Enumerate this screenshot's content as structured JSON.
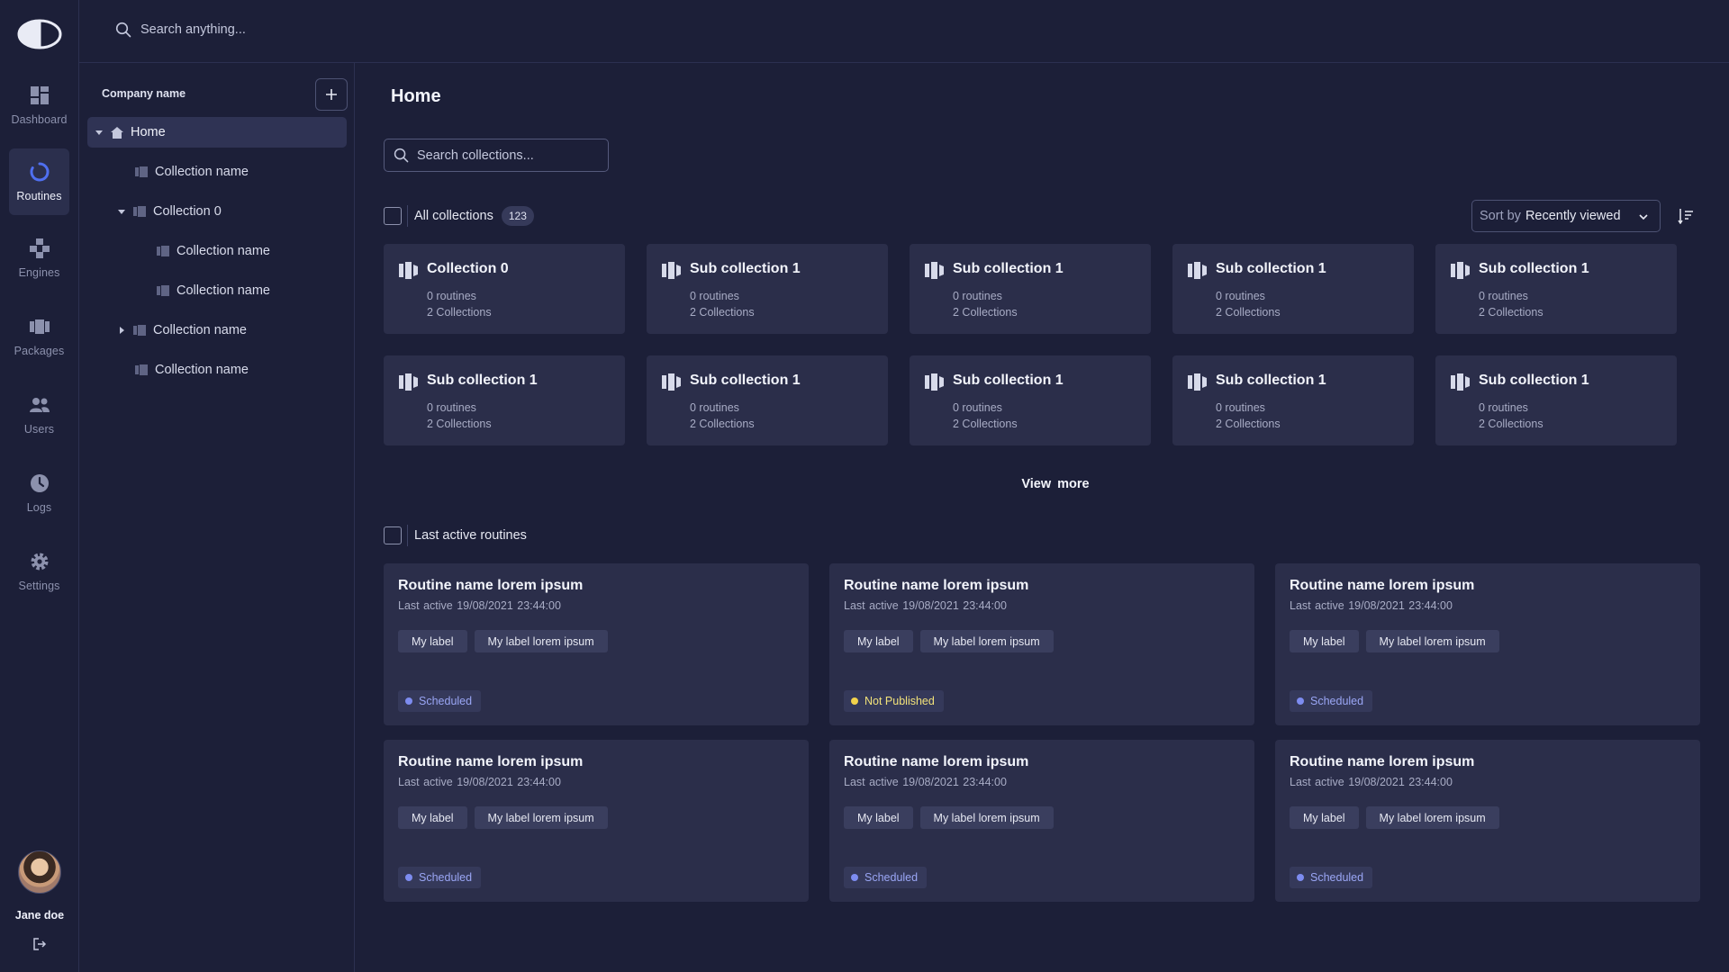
{
  "app": {
    "search_placeholder": "Search anything..."
  },
  "nav": {
    "items": [
      {
        "label": "Dashboard",
        "icon": "dashboard-icon"
      },
      {
        "label": "Routines",
        "icon": "routines-icon",
        "active": true
      },
      {
        "label": "Engines",
        "icon": "engines-icon"
      },
      {
        "label": "Packages",
        "icon": "packages-icon"
      },
      {
        "label": "Users",
        "icon": "users-icon"
      },
      {
        "label": "Logs",
        "icon": "logs-icon"
      },
      {
        "label": "Settings",
        "icon": "settings-icon"
      }
    ],
    "user_name": "Jane doe"
  },
  "tree": {
    "company": "Company name",
    "items": [
      {
        "label": "Home",
        "depth": 0,
        "expanded": true,
        "selected": true,
        "icon": "home-icon"
      },
      {
        "label": "Collection name",
        "depth": 1,
        "icon": "folder-icon"
      },
      {
        "label": "Collection 0",
        "depth": 1,
        "expanded": true,
        "icon": "folder-icon"
      },
      {
        "label": "Collection name",
        "depth": 2,
        "icon": "folder-icon"
      },
      {
        "label": "Collection name",
        "depth": 2,
        "icon": "folder-icon"
      },
      {
        "label": "Collection name",
        "depth": 1,
        "expanded": false,
        "icon": "folder-icon"
      },
      {
        "label": "Collection name",
        "depth": 1,
        "icon": "folder-icon"
      }
    ]
  },
  "main": {
    "title": "Home",
    "search_placeholder": "Search collections...",
    "all_collections_label": "All collections",
    "all_collections_count": "123",
    "sort_prefix": "Sort by",
    "sort_value": "Recently viewed",
    "collections": [
      {
        "title": "Collection 0",
        "routines": "0 routines",
        "collections": "2 Collections"
      },
      {
        "title": "Sub collection 1",
        "routines": "0 routines",
        "collections": "2 Collections"
      },
      {
        "title": "Sub collection 1",
        "routines": "0 routines",
        "collections": "2 Collections"
      },
      {
        "title": "Sub collection 1",
        "routines": "0 routines",
        "collections": "2 Collections"
      },
      {
        "title": "Sub collection 1",
        "routines": "0 routines",
        "collections": "2 Collections"
      },
      {
        "title": "Sub collection 1",
        "routines": "0 routines",
        "collections": "2 Collections"
      },
      {
        "title": "Sub collection 1",
        "routines": "0 routines",
        "collections": "2 Collections"
      },
      {
        "title": "Sub collection 1",
        "routines": "0 routines",
        "collections": "2 Collections"
      },
      {
        "title": "Sub collection 1",
        "routines": "0 routines",
        "collections": "2 Collections"
      },
      {
        "title": "Sub collection 1",
        "routines": "0 routines",
        "collections": "2 Collections"
      }
    ],
    "view_more": "View more",
    "routines_label": "Last active routines",
    "routines": [
      {
        "title": "Routine name lorem ipsum",
        "last_active": "Last active  19/08/2021 23:44:00",
        "tags": [
          "My label",
          "My label lorem ipsum"
        ],
        "status": "Scheduled",
        "status_color": "#7d8cf0",
        "status_text_color": "#9aa6f5"
      },
      {
        "title": "Routine name lorem ipsum",
        "last_active": "Last active  19/08/2021 23:44:00",
        "tags": [
          "My label",
          "My label lorem ipsum"
        ],
        "status": "Not Published",
        "status_color": "#f2d24b",
        "status_text_color": "#f2e27a"
      },
      {
        "title": "Routine name lorem ipsum",
        "last_active": "Last active  19/08/2021 23:44:00",
        "tags": [
          "My label",
          "My label lorem ipsum"
        ],
        "status": "Scheduled",
        "status_color": "#7d8cf0",
        "status_text_color": "#9aa6f5"
      },
      {
        "title": "Routine name lorem ipsum",
        "last_active": "Last active  19/08/2021 23:44:00",
        "tags": [
          "My label",
          "My label lorem ipsum"
        ],
        "status": "Scheduled",
        "status_color": "#7d8cf0",
        "status_text_color": "#9aa6f5"
      },
      {
        "title": "Routine name lorem ipsum",
        "last_active": "Last active  19/08/2021 23:44:00",
        "tags": [
          "My label",
          "My label lorem ipsum"
        ],
        "status": "Scheduled",
        "status_color": "#7d8cf0",
        "status_text_color": "#9aa6f5"
      },
      {
        "title": "Routine name lorem ipsum",
        "last_active": "Last active  19/08/2021 23:44:00",
        "tags": [
          "My label",
          "My label lorem ipsum"
        ],
        "status": "Scheduled",
        "status_color": "#7d8cf0",
        "status_text_color": "#9aa6f5"
      }
    ]
  }
}
